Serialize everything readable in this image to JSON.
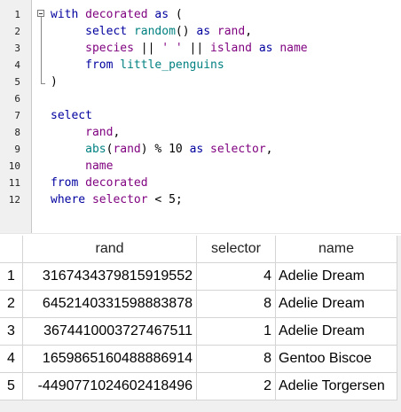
{
  "editor": {
    "line_numbers": [
      "1",
      "2",
      "3",
      "4",
      "5",
      "6",
      "7",
      "8",
      "9",
      "10",
      "11",
      "12"
    ],
    "lines": [
      [
        {
          "t": "kw",
          "v": "with"
        },
        {
          "t": "op",
          "v": " "
        },
        {
          "t": "id",
          "v": "decorated"
        },
        {
          "t": "op",
          "v": " "
        },
        {
          "t": "kw",
          "v": "as"
        },
        {
          "t": "op",
          "v": " ("
        }
      ],
      [
        {
          "t": "op",
          "v": "     "
        },
        {
          "t": "kw",
          "v": "select"
        },
        {
          "t": "op",
          "v": " "
        },
        {
          "t": "fn",
          "v": "random"
        },
        {
          "t": "op",
          "v": "() "
        },
        {
          "t": "kw",
          "v": "as"
        },
        {
          "t": "op",
          "v": " "
        },
        {
          "t": "id",
          "v": "rand"
        },
        {
          "t": "op",
          "v": ","
        }
      ],
      [
        {
          "t": "op",
          "v": "     "
        },
        {
          "t": "id",
          "v": "species"
        },
        {
          "t": "op",
          "v": " || "
        },
        {
          "t": "st",
          "v": "' '"
        },
        {
          "t": "op",
          "v": " || "
        },
        {
          "t": "id",
          "v": "island"
        },
        {
          "t": "op",
          "v": " "
        },
        {
          "t": "kw",
          "v": "as"
        },
        {
          "t": "op",
          "v": " "
        },
        {
          "t": "id",
          "v": "name"
        }
      ],
      [
        {
          "t": "op",
          "v": "     "
        },
        {
          "t": "kw",
          "v": "from"
        },
        {
          "t": "op",
          "v": " "
        },
        {
          "t": "tb",
          "v": "little_penguins"
        }
      ],
      [
        {
          "t": "op",
          "v": ")"
        }
      ],
      [],
      [
        {
          "t": "kw",
          "v": "select"
        }
      ],
      [
        {
          "t": "op",
          "v": "     "
        },
        {
          "t": "id",
          "v": "rand"
        },
        {
          "t": "op",
          "v": ","
        }
      ],
      [
        {
          "t": "op",
          "v": "     "
        },
        {
          "t": "fn",
          "v": "abs"
        },
        {
          "t": "op",
          "v": "("
        },
        {
          "t": "id",
          "v": "rand"
        },
        {
          "t": "op",
          "v": ") % "
        },
        {
          "t": "nm",
          "v": "10"
        },
        {
          "t": "op",
          "v": " "
        },
        {
          "t": "kw",
          "v": "as"
        },
        {
          "t": "op",
          "v": " "
        },
        {
          "t": "id",
          "v": "selector"
        },
        {
          "t": "op",
          "v": ","
        }
      ],
      [
        {
          "t": "op",
          "v": "     "
        },
        {
          "t": "id",
          "v": "name"
        }
      ],
      [
        {
          "t": "kw",
          "v": "from"
        },
        {
          "t": "op",
          "v": " "
        },
        {
          "t": "id",
          "v": "decorated"
        }
      ],
      [
        {
          "t": "kw",
          "v": "where"
        },
        {
          "t": "op",
          "v": " "
        },
        {
          "t": "id",
          "v": "selector"
        },
        {
          "t": "op",
          "v": " < "
        },
        {
          "t": "nm",
          "v": "5"
        },
        {
          "t": "op",
          "v": ";"
        }
      ]
    ]
  },
  "results": {
    "columns": [
      "rand",
      "selector",
      "name"
    ],
    "rows": [
      {
        "row_num": "1",
        "rand": "3167434379815919552",
        "selector": "4",
        "name": "Adelie Dream"
      },
      {
        "row_num": "2",
        "rand": "6452140331598883878",
        "selector": "8",
        "name": "Adelie Dream"
      },
      {
        "row_num": "3",
        "rand": "3674410003727467511",
        "selector": "1",
        "name": "Adelie Dream"
      },
      {
        "row_num": "4",
        "rand": "1659865160488886914",
        "selector": "8",
        "name": "Gentoo Biscoe"
      },
      {
        "row_num": "5",
        "rand": "-4490771024602418496",
        "selector": "2",
        "name": "Adelie Torgersen"
      }
    ]
  }
}
